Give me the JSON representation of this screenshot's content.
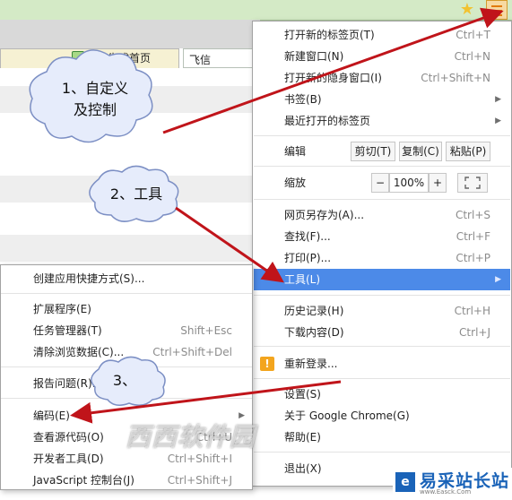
{
  "browser": {
    "tab_label": "生成首页",
    "address_text": "飞信"
  },
  "main_menu": {
    "items": [
      {
        "label": "打开新的标签页(T)",
        "shortcut": "Ctrl+T"
      },
      {
        "label": "新建窗口(N)",
        "shortcut": "Ctrl+N"
      },
      {
        "label": "打开新的隐身窗口(I)",
        "shortcut": "Ctrl+Shift+N"
      },
      {
        "label": "书签(B)",
        "shortcut": ""
      },
      {
        "label": "最近打开的标签页",
        "shortcut": ""
      }
    ],
    "edit": {
      "label": "编辑",
      "cut": "剪切(T)",
      "copy": "复制(C)",
      "paste": "粘贴(P)"
    },
    "zoom": {
      "label": "缩放",
      "minus": "−",
      "value": "100%",
      "plus": "+"
    },
    "items2": [
      {
        "label": "网页另存为(A)...",
        "shortcut": "Ctrl+S"
      },
      {
        "label": "查找(F)...",
        "shortcut": "Ctrl+F"
      },
      {
        "label": "打印(P)...",
        "shortcut": "Ctrl+P"
      },
      {
        "label": "工具(L)",
        "shortcut": ""
      }
    ],
    "items3": [
      {
        "label": "历史记录(H)",
        "shortcut": "Ctrl+H"
      },
      {
        "label": "下载内容(D)",
        "shortcut": "Ctrl+J"
      }
    ],
    "relogin": {
      "label": "重新登录...",
      "icon": "!"
    },
    "items4": [
      {
        "label": "设置(S)"
      },
      {
        "label": "关于 Google Chrome(G)"
      },
      {
        "label": "帮助(E)"
      }
    ],
    "exit": {
      "label": "退出(X)"
    }
  },
  "sub_menu": {
    "items": [
      {
        "label": "创建应用快捷方式(S)...",
        "shortcut": ""
      },
      {
        "label": "扩展程序(E)",
        "shortcut": ""
      },
      {
        "label": "任务管理器(T)",
        "shortcut": "Shift+Esc"
      },
      {
        "label": "清除浏览数据(C)...",
        "shortcut": "Ctrl+Shift+Del"
      },
      {
        "label": "报告问题(R)...",
        "shortcut": ""
      },
      {
        "label": "编码(E)",
        "shortcut": ""
      },
      {
        "label": "查看源代码(O)",
        "shortcut": "Ctrl+U"
      },
      {
        "label": "开发者工具(D)",
        "shortcut": "Ctrl+Shift+I"
      },
      {
        "label": "JavaScript 控制台(J)",
        "shortcut": "Ctrl+Shift+J"
      }
    ]
  },
  "callouts": {
    "one_line1": "1、自定义",
    "one_line2": "及控制",
    "two": "2、工具",
    "three": "3、"
  },
  "watermark": "西西软件园",
  "logo": {
    "mark": "e",
    "text": "易采站长站",
    "url": "www.Easck.Com"
  },
  "colors": {
    "highlight": "#4c8ae8",
    "arrow": "#c0141a",
    "logo": "#1a63b8"
  },
  "icons": [
    "star-icon",
    "chrome-menu-icon",
    "warning-icon",
    "submenu-arrow-icon",
    "fullscreen-icon"
  ]
}
